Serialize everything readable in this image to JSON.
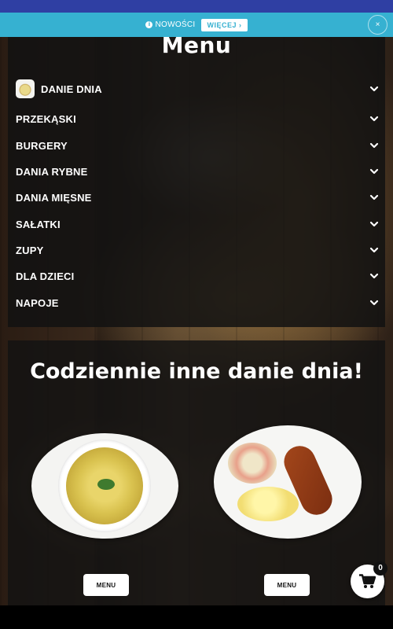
{
  "notice": {
    "text": "NOWOŚCI",
    "more_label": "WIĘCEJ",
    "close_glyph": "×",
    "info_glyph": "i"
  },
  "menu": {
    "title": "Menu",
    "items": [
      {
        "label": "DANIE DNIA",
        "icon": "dish-thumbnail"
      },
      {
        "label": "PRZEKĄSKI"
      },
      {
        "label": "BURGERY"
      },
      {
        "label": "DANIA RYBNE"
      },
      {
        "label": "DANIA MIĘSNE"
      },
      {
        "label": "SAŁATKI"
      },
      {
        "label": "ZUPY"
      },
      {
        "label": "DLA DZIECI"
      },
      {
        "label": "NAPOJE"
      }
    ]
  },
  "daily": {
    "heading": "Codziennie inne danie dnia!",
    "buttons": [
      "MENU",
      "MENU"
    ]
  },
  "cart": {
    "count": "0",
    "icon": "cart-icon"
  },
  "colors": {
    "top_strip": "#2f3fa3",
    "notice_bg": "#36b1d1",
    "panel_bg": "#121212"
  }
}
